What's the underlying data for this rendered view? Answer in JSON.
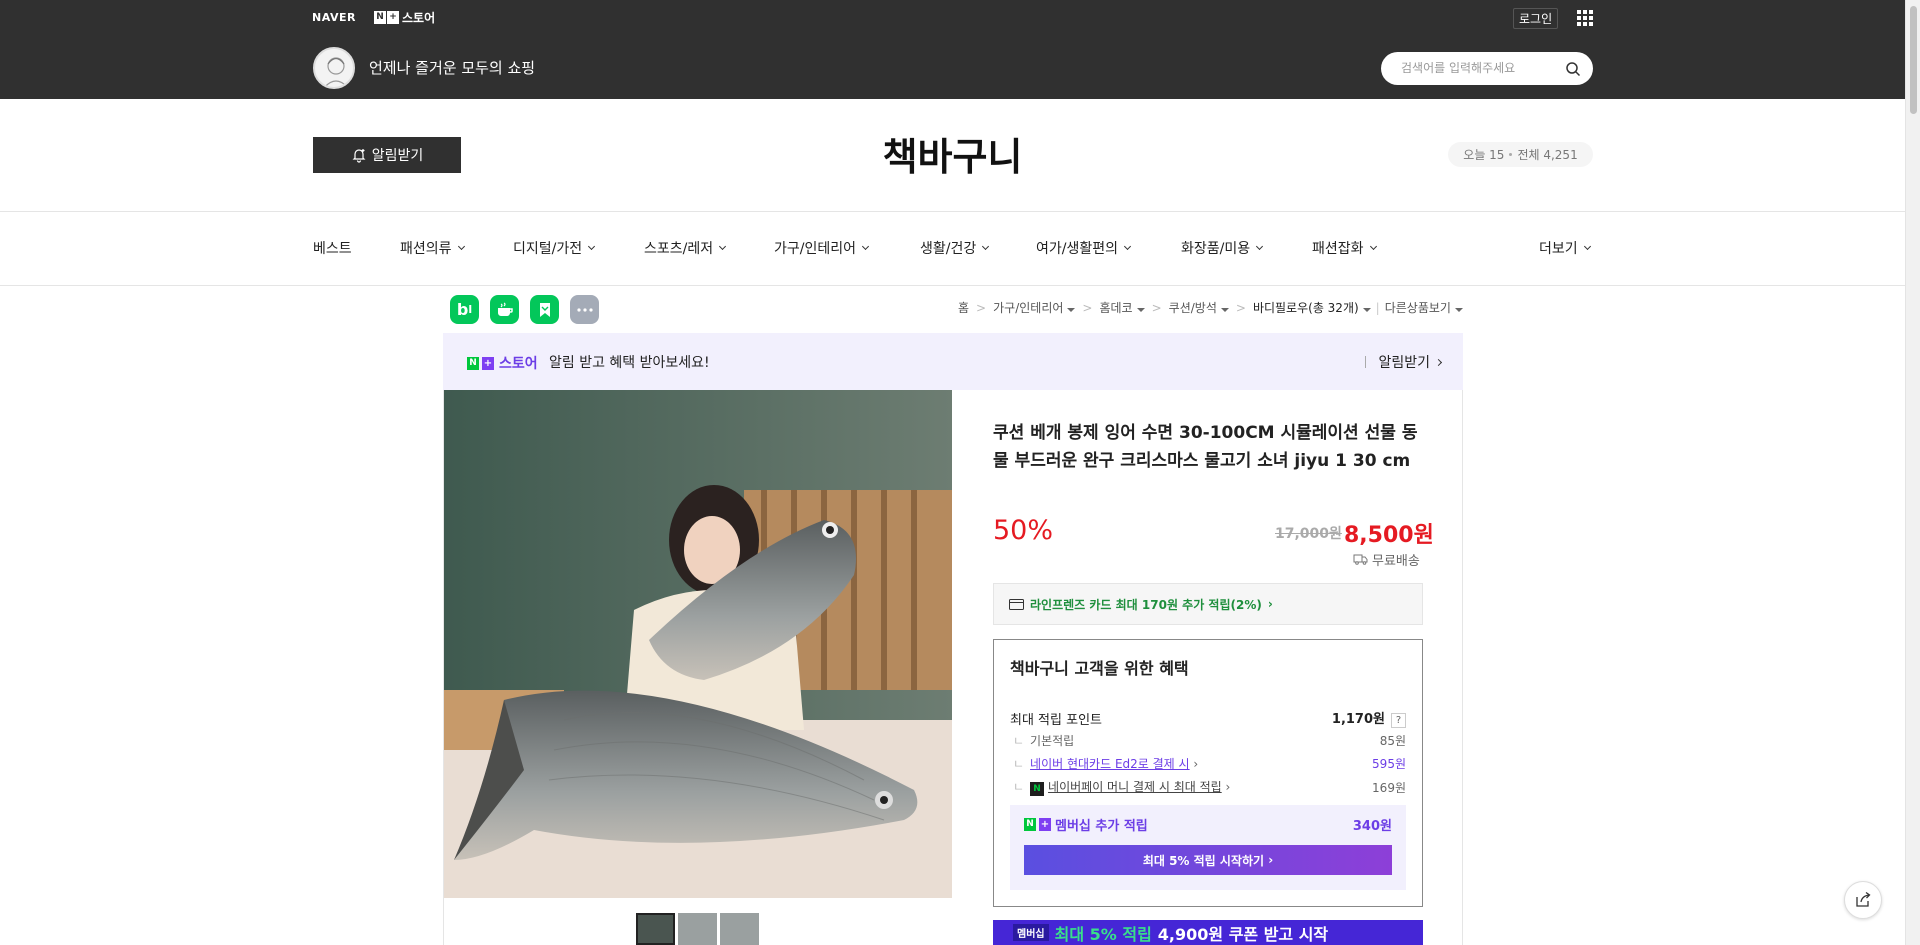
{
  "gnb": {
    "naver_logo": "NAVER",
    "store_logo_n": "N",
    "store_logo_plus": "+",
    "store_logo_text": "스토어",
    "login": "로그인",
    "tagline": "언제나 즐거운 모두의 쇼핑",
    "search_placeholder": "검색어를 입력해주세요"
  },
  "store": {
    "alarm_button": "알림받기",
    "title": "책바구니",
    "visits_today": "오늘 15",
    "visits_total": "전체 4,251"
  },
  "nav": [
    "베스트",
    "패션의류",
    "디지털/가전",
    "스포츠/레저",
    "가구/인테리어",
    "생활/건강",
    "여가/생활편의",
    "화장품/미용",
    "패션잡화",
    "더보기"
  ],
  "social_buttons": [
    "blog-icon",
    "talk-icon",
    "bookmark-icon",
    "more-icon"
  ],
  "breadcrumb": {
    "items": [
      "홈",
      "가구/인테리어",
      "홈데코",
      "쿠션/방석"
    ],
    "current": "바디필로우(총 32개)",
    "other": "다른상품보기"
  },
  "alert_banner": {
    "store_text": "스토어",
    "message": "알림 받고 혜택 받아보세요!",
    "button": "알림받기"
  },
  "product": {
    "title": "쿠션 베개 봉제 잉어 수면 30-100CM 시뮬레이션 선물 동물 부드러운 완구 크리스마스 물고기 소녀 jiyu 1 30 cm",
    "discount": "50%",
    "original_price": "17,000원",
    "price": "8,500원",
    "shipping": "무료배송",
    "card_offer": "라인프렌즈 카드 최대 170원 추가 적립(2%)"
  },
  "benefit": {
    "title": "책바구니 고객을 위한 혜택",
    "max_label": "최대 적립 포인트",
    "max_value": "1,170원",
    "rows": [
      {
        "label": "기본적립",
        "value": "85원"
      },
      {
        "label": "네이버 현대카드 Ed2로 결제 시",
        "value": "595원"
      },
      {
        "label": "네이버페이 머니 결제 시 최대 적립",
        "value": "169원"
      }
    ],
    "membership_label": "멤버십 추가 적립",
    "membership_value": "340원",
    "membership_button": "최대 5% 적립 시작하기"
  },
  "promo": {
    "tag": "멤버십",
    "text": "최대 5% 적립",
    "text2": "4,900원 쿠폰 받고 시작"
  },
  "colors": {
    "header_bg": "#303030",
    "accent_red": "#e51a22",
    "naver_green": "#00c73c",
    "membership_purple": "#6c3ee6"
  }
}
